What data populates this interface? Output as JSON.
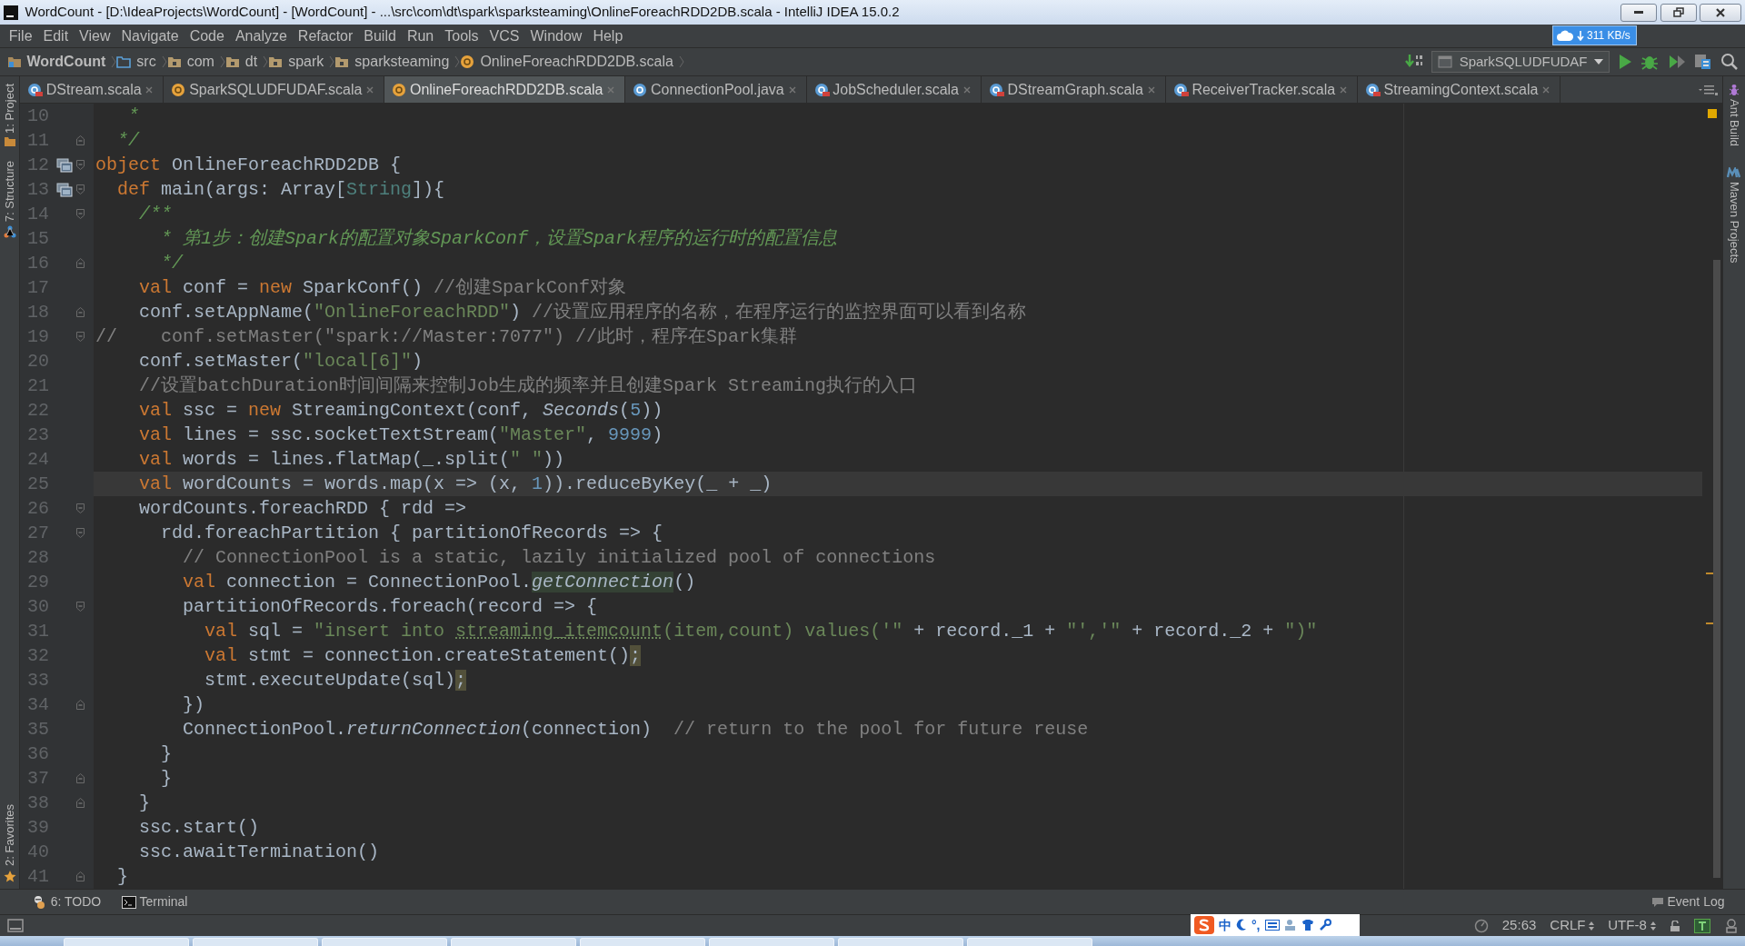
{
  "window": {
    "title": "WordCount - [D:\\IdeaProjects\\WordCount] - [WordCount] - ...\\src\\com\\dt\\spark\\sparksteaming\\OnlineForeachRDD2DB.scala - IntelliJ IDEA 15.0.2"
  },
  "menu": [
    "File",
    "Edit",
    "View",
    "Navigate",
    "Code",
    "Analyze",
    "Refactor",
    "Build",
    "Run",
    "Tools",
    "VCS",
    "Window",
    "Help"
  ],
  "network_widget": {
    "speed": "311 KB/s"
  },
  "breadcrumbs": [
    {
      "label": "WordCount",
      "kind": "module"
    },
    {
      "label": "src",
      "kind": "source"
    },
    {
      "label": "com",
      "kind": "package"
    },
    {
      "label": "dt",
      "kind": "package"
    },
    {
      "label": "spark",
      "kind": "package"
    },
    {
      "label": "sparksteaming",
      "kind": "package"
    },
    {
      "label": "OnlineForeachRDD2DB.scala",
      "kind": "object"
    }
  ],
  "toolbar": {
    "run_config": "SparkSQLUDFUDAF"
  },
  "left_stripe": [
    "1: Project",
    "7: Structure",
    "2: Favorites"
  ],
  "right_stripe": [
    {
      "label": "Ant Build",
      "kind": "ant"
    },
    {
      "label": "Maven Projects",
      "kind": "maven"
    }
  ],
  "tabs": [
    {
      "label": "DStream.scala",
      "kind": "scala-class",
      "selected": false
    },
    {
      "label": "SparkSQLUDFUDAF.scala",
      "kind": "object",
      "selected": false
    },
    {
      "label": "OnlineForeachRDD2DB.scala",
      "kind": "object",
      "selected": true
    },
    {
      "label": "ConnectionPool.java",
      "kind": "java-class",
      "selected": false
    },
    {
      "label": "JobScheduler.scala",
      "kind": "scala-class",
      "selected": false
    },
    {
      "label": "DStreamGraph.scala",
      "kind": "scala-class",
      "selected": false
    },
    {
      "label": "ReceiverTracker.scala",
      "kind": "scala-class",
      "selected": false
    },
    {
      "label": "StreamingContext.scala",
      "kind": "scala-class",
      "selected": false
    }
  ],
  "editor": {
    "lines": [
      {
        "number": "10",
        "current": false,
        "fold_start": false,
        "fold_end": false,
        "override": false,
        "tokens": [
          {
            "kind": "doc",
            "text": "   *"
          }
        ]
      },
      {
        "number": "11",
        "current": false,
        "fold_start": false,
        "fold_end": true,
        "override": false,
        "tokens": [
          {
            "kind": "doc",
            "text": "  */"
          }
        ]
      },
      {
        "number": "12",
        "current": false,
        "fold_start": true,
        "fold_end": false,
        "override": true,
        "tokens": [
          {
            "kind": "kw",
            "text": "object"
          },
          {
            "kind": "plain",
            "text": " OnlineForeachRDD2DB {"
          }
        ]
      },
      {
        "number": "13",
        "current": false,
        "fold_start": true,
        "fold_end": false,
        "override": true,
        "tokens": [
          {
            "kind": "kw",
            "text": "  def"
          },
          {
            "kind": "plain",
            "text": " main(args: Array["
          },
          {
            "kind": "type",
            "text": "String"
          },
          {
            "kind": "plain",
            "text": "]){"
          }
        ]
      },
      {
        "number": "14",
        "current": false,
        "fold_start": true,
        "fold_end": false,
        "override": false,
        "tokens": [
          {
            "kind": "doc",
            "text": "    /**"
          }
        ]
      },
      {
        "number": "15",
        "current": false,
        "fold_start": false,
        "fold_end": false,
        "override": false,
        "tokens": [
          {
            "kind": "doc",
            "text": "      * 第1步：创建Spark的配置对象SparkConf，设置Spark程序的运行时的配置信息"
          }
        ]
      },
      {
        "number": "16",
        "current": false,
        "fold_start": false,
        "fold_end": true,
        "override": false,
        "tokens": [
          {
            "kind": "doc",
            "text": "      */"
          }
        ]
      },
      {
        "number": "17",
        "current": false,
        "fold_start": false,
        "fold_end": false,
        "override": false,
        "tokens": [
          {
            "kind": "kw",
            "text": "    val"
          },
          {
            "kind": "plain",
            "text": " conf = "
          },
          {
            "kind": "kw",
            "text": "new"
          },
          {
            "kind": "plain",
            "text": " SparkConf() "
          },
          {
            "kind": "cmt",
            "text": "//创建SparkConf对象"
          }
        ]
      },
      {
        "number": "18",
        "current": false,
        "fold_start": false,
        "fold_end": true,
        "override": false,
        "tokens": [
          {
            "kind": "plain",
            "text": "    conf.setAppName("
          },
          {
            "kind": "str",
            "text": "\"OnlineForeachRDD\""
          },
          {
            "kind": "plain",
            "text": ") "
          },
          {
            "kind": "cmt",
            "text": "//设置应用程序的名称，在程序运行的监控界面可以看到名称"
          }
        ]
      },
      {
        "number": "19",
        "current": false,
        "fold_start": true,
        "fold_end": false,
        "override": false,
        "tokens": [
          {
            "kind": "cmt",
            "text": "//    conf.setMaster(\"spark://Master:7077\") //此时，程序在Spark集群"
          }
        ]
      },
      {
        "number": "20",
        "current": false,
        "fold_start": false,
        "fold_end": false,
        "override": false,
        "tokens": [
          {
            "kind": "plain",
            "text": "    conf.setMaster("
          },
          {
            "kind": "str",
            "text": "\"local[6]\""
          },
          {
            "kind": "plain",
            "text": ")"
          }
        ]
      },
      {
        "number": "21",
        "current": false,
        "fold_start": false,
        "fold_end": false,
        "override": false,
        "tokens": [
          {
            "kind": "cmt",
            "text": "    //设置batchDuration时间间隔来控制Job生成的频率并且创建Spark Streaming执行的入口"
          }
        ]
      },
      {
        "number": "22",
        "current": false,
        "fold_start": false,
        "fold_end": false,
        "override": false,
        "tokens": [
          {
            "kind": "kw",
            "text": "    val"
          },
          {
            "kind": "plain",
            "text": " ssc = "
          },
          {
            "kind": "kw",
            "text": "new"
          },
          {
            "kind": "plain",
            "text": " StreamingContext(conf, "
          },
          {
            "kind": "italic",
            "text": "Seconds"
          },
          {
            "kind": "plain",
            "text": "("
          },
          {
            "kind": "num",
            "text": "5"
          },
          {
            "kind": "plain",
            "text": "))"
          }
        ]
      },
      {
        "number": "23",
        "current": false,
        "fold_start": false,
        "fold_end": false,
        "override": false,
        "tokens": [
          {
            "kind": "kw",
            "text": "    val"
          },
          {
            "kind": "plain",
            "text": " lines = ssc.socketTextStream("
          },
          {
            "kind": "str",
            "text": "\"Master\""
          },
          {
            "kind": "plain",
            "text": ", "
          },
          {
            "kind": "num",
            "text": "9999"
          },
          {
            "kind": "plain",
            "text": ")"
          }
        ]
      },
      {
        "number": "24",
        "current": false,
        "fold_start": false,
        "fold_end": false,
        "override": false,
        "tokens": [
          {
            "kind": "kw",
            "text": "    val"
          },
          {
            "kind": "plain",
            "text": " words = lines.flatMap(_.split("
          },
          {
            "kind": "str",
            "text": "\" \""
          },
          {
            "kind": "plain",
            "text": "))"
          }
        ]
      },
      {
        "number": "25",
        "current": true,
        "fold_start": false,
        "fold_end": false,
        "override": false,
        "tokens": [
          {
            "kind": "kw",
            "text": "    val"
          },
          {
            "kind": "plain",
            "text": " wordCounts = words.map(x => (x, "
          },
          {
            "kind": "num",
            "text": "1"
          },
          {
            "kind": "plain",
            "text": ")).reduceByKey(_ + _)"
          }
        ]
      },
      {
        "number": "26",
        "current": false,
        "fold_start": true,
        "fold_end": false,
        "override": false,
        "tokens": [
          {
            "kind": "plain",
            "text": "    wordCounts.foreachRDD { rdd =>"
          }
        ]
      },
      {
        "number": "27",
        "current": false,
        "fold_start": true,
        "fold_end": false,
        "override": false,
        "tokens": [
          {
            "kind": "plain",
            "text": "      rdd.foreachPartition { partitionOfRecords => {"
          }
        ]
      },
      {
        "number": "28",
        "current": false,
        "fold_start": false,
        "fold_end": false,
        "override": false,
        "tokens": [
          {
            "kind": "cmt",
            "text": "        // ConnectionPool is a static, lazily initialized pool of connections"
          }
        ]
      },
      {
        "number": "29",
        "current": false,
        "fold_start": false,
        "fold_end": false,
        "override": false,
        "tokens": [
          {
            "kind": "kw",
            "text": "        val"
          },
          {
            "kind": "plain",
            "text": " connection = ConnectionPool."
          },
          {
            "kind": "usage",
            "text": "getConnection"
          },
          {
            "kind": "plain",
            "text": "()"
          }
        ]
      },
      {
        "number": "30",
        "current": false,
        "fold_start": true,
        "fold_end": false,
        "override": false,
        "tokens": [
          {
            "kind": "plain",
            "text": "        partitionOfRecords.foreach(record => {"
          }
        ]
      },
      {
        "number": "31",
        "current": false,
        "fold_start": false,
        "fold_end": false,
        "override": false,
        "tokens": [
          {
            "kind": "kw",
            "text": "          val"
          },
          {
            "kind": "plain",
            "text": " sql = "
          },
          {
            "kind": "str",
            "text": "\"insert into "
          },
          {
            "kind": "typo",
            "text": "streaming_itemcount"
          },
          {
            "kind": "str",
            "text": "(item,count) values('\""
          },
          {
            "kind": "plain",
            "text": " + record._1 + "
          },
          {
            "kind": "str",
            "text": "\"','\""
          },
          {
            "kind": "plain",
            "text": " + record._2 + "
          },
          {
            "kind": "str",
            "text": "\")\""
          }
        ]
      },
      {
        "number": "32",
        "current": false,
        "fold_start": false,
        "fold_end": false,
        "override": false,
        "tokens": [
          {
            "kind": "kw",
            "text": "          val"
          },
          {
            "kind": "plain",
            "text": " stmt = connection.createStatement()"
          },
          {
            "kind": "warn",
            "text": ";"
          }
        ]
      },
      {
        "number": "33",
        "current": false,
        "fold_start": false,
        "fold_end": false,
        "override": false,
        "tokens": [
          {
            "kind": "plain",
            "text": "          stmt.executeUpdate(sql)"
          },
          {
            "kind": "warn",
            "text": ";"
          }
        ]
      },
      {
        "number": "34",
        "current": false,
        "fold_start": false,
        "fold_end": true,
        "override": false,
        "tokens": [
          {
            "kind": "plain",
            "text": "        })"
          }
        ]
      },
      {
        "number": "35",
        "current": false,
        "fold_start": false,
        "fold_end": false,
        "override": false,
        "tokens": [
          {
            "kind": "plain",
            "text": "        ConnectionPool."
          },
          {
            "kind": "italic",
            "text": "returnConnection"
          },
          {
            "kind": "plain",
            "text": "(connection)  "
          },
          {
            "kind": "cmt",
            "text": "// return to the pool for future reuse"
          }
        ]
      },
      {
        "number": "36",
        "current": false,
        "fold_start": false,
        "fold_end": false,
        "override": false,
        "tokens": [
          {
            "kind": "plain",
            "text": "      }"
          }
        ]
      },
      {
        "number": "37",
        "current": false,
        "fold_start": false,
        "fold_end": true,
        "override": false,
        "tokens": [
          {
            "kind": "plain",
            "text": "      }"
          }
        ]
      },
      {
        "number": "38",
        "current": false,
        "fold_start": false,
        "fold_end": true,
        "override": false,
        "tokens": [
          {
            "kind": "plain",
            "text": "    }"
          }
        ]
      },
      {
        "number": "39",
        "current": false,
        "fold_start": false,
        "fold_end": false,
        "override": false,
        "tokens": [
          {
            "kind": "plain",
            "text": "    ssc.start()"
          }
        ]
      },
      {
        "number": "40",
        "current": false,
        "fold_start": false,
        "fold_end": false,
        "override": false,
        "tokens": [
          {
            "kind": "plain",
            "text": "    ssc.awaitTermination()"
          }
        ]
      },
      {
        "number": "41",
        "current": false,
        "fold_start": false,
        "fold_end": true,
        "override": false,
        "tokens": [
          {
            "kind": "plain",
            "text": "  }"
          }
        ]
      }
    ]
  },
  "tool_windows": [
    {
      "label": "6: TODO",
      "kind": "todo"
    },
    {
      "label": "Terminal",
      "kind": "terminal"
    }
  ],
  "event_log": "Event Log",
  "ime": {
    "mode": "中",
    "punctuation": "°,"
  },
  "status": {
    "position": "25:63",
    "line_separator": "CRLF",
    "encoding": "UTF-8"
  }
}
